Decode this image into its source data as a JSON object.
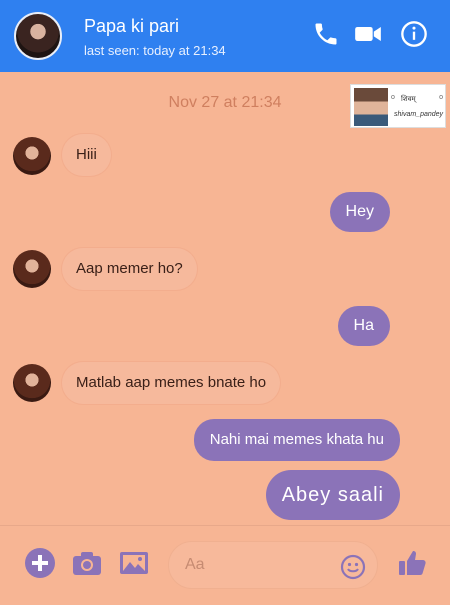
{
  "header": {
    "title": "Papa ki pari",
    "status": "last seen: today at 21:34"
  },
  "thread": {
    "date": "Nov 27 at 21:34",
    "messages": [
      {
        "dir": "in",
        "text": "Hiii"
      },
      {
        "dir": "out",
        "text": "Hey"
      },
      {
        "dir": "in",
        "text": "Aap memer ho?"
      },
      {
        "dir": "out",
        "text": "Ha"
      },
      {
        "dir": "in",
        "text": "Matlab aap memes bnate ho"
      },
      {
        "dir": "out",
        "text": "Nahi mai memes khata hu"
      },
      {
        "dir": "out",
        "text": "Abey saali"
      }
    ]
  },
  "watermark": {
    "name": "शिवम्",
    "handle": "shivam_pandey"
  },
  "composer": {
    "placeholder": "Aa"
  },
  "colors": {
    "header_bg": "#2f80f0",
    "chat_bg": "#f7b594",
    "outgoing_bubble": "#8b73b8",
    "accent_icons": "#8b73b8"
  },
  "icons": {
    "header": [
      "phone-icon",
      "video-icon",
      "info-icon"
    ],
    "composer": [
      "plus-icon",
      "camera-icon",
      "gallery-icon",
      "emoji-icon",
      "like-icon"
    ]
  }
}
